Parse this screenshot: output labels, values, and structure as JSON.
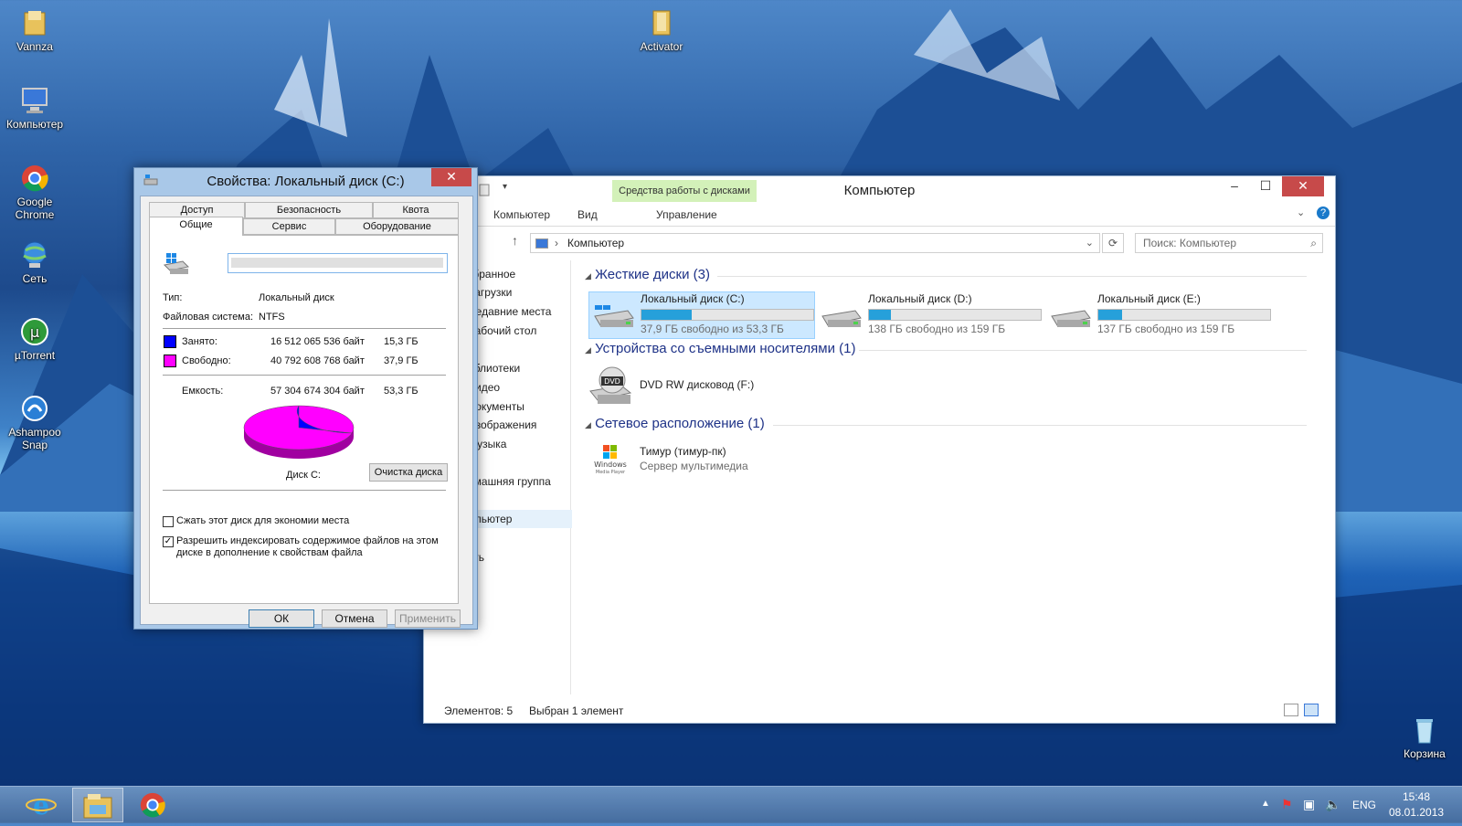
{
  "desktop": {
    "icons": [
      {
        "label": "Vannza",
        "icon": "folder-icon"
      },
      {
        "label": "Компьютер",
        "icon": "computer-icon"
      },
      {
        "label": "Google Chrome",
        "icon": "chrome-icon"
      },
      {
        "label": "Сеть",
        "icon": "network-icon"
      },
      {
        "label": "µTorrent",
        "icon": "utorrent-icon"
      },
      {
        "label": "Ashampoo Snap",
        "icon": "ashampoo-icon"
      },
      {
        "label": "Activator",
        "icon": "folder-icon"
      },
      {
        "label": "Корзина",
        "icon": "recycle-bin-icon"
      }
    ]
  },
  "explorer": {
    "title": "Компьютер",
    "context_tab": "Средства работы с дисками",
    "ribbon": {
      "tab_computer": "Компьютер",
      "tab_view": "Вид",
      "tab_manage": "Управление"
    },
    "address": "Компьютер",
    "search_placeholder": "Поиск: Компьютер",
    "nav": [
      "збранное",
      "Загрузки",
      "Недавние места",
      "Рабочий стол",
      "иблиотеки",
      "Видео",
      "Документы",
      "Изображения",
      "Музыка",
      "омашняя группа",
      "мпьютер",
      "еть"
    ],
    "groups": {
      "hard_disks": "Жесткие диски (3)",
      "removable": "Устройства со съемными носителями (1)",
      "network": "Сетевое расположение (1)"
    },
    "drives": [
      {
        "name": "Локальный диск (C:)",
        "free": "37,9 ГБ свободно из 53,3 ГБ",
        "used_fraction": 0.29
      },
      {
        "name": "Локальный диск (D:)",
        "free": "138 ГБ свободно из 159 ГБ",
        "used_fraction": 0.13
      },
      {
        "name": "Локальный диск (E:)",
        "free": "137 ГБ свободно из 159 ГБ",
        "used_fraction": 0.14
      }
    ],
    "dvd": {
      "name": "DVD RW дисковод (F:)",
      "badge": "DVD"
    },
    "media": {
      "name": "Тимур (тимур-пк)",
      "sub": "Сервер мультимедиа",
      "logo1": "Windows",
      "logo2": "Media Player"
    },
    "status": {
      "count": "Элементов: 5",
      "selected": "Выбран 1 элемент"
    }
  },
  "props": {
    "title": "Свойства: Локальный диск (C:)",
    "tabs_row1": [
      "Доступ",
      "Безопасность",
      "Квота"
    ],
    "tabs_row2": [
      "Общие",
      "Сервис",
      "Оборудование"
    ],
    "name_value": "",
    "type_label": "Тип:",
    "type_value": "Локальный диск",
    "fs_label": "Файловая система:",
    "fs_value": "NTFS",
    "used": {
      "label": "Занято:",
      "bytes": "16 512 065 536 байт",
      "size": "15,3 ГБ",
      "color": "#0000ff",
      "fraction": 0.29
    },
    "free": {
      "label": "Свободно:",
      "bytes": "40 792 608 768 байт",
      "size": "37,9 ГБ",
      "color": "#ff00ff",
      "fraction": 0.71
    },
    "capacity": {
      "label": "Емкость:",
      "bytes": "57 304 674 304 байт",
      "size": "53,3 ГБ"
    },
    "disk_label": "Диск C:",
    "cleanup": "Очистка диска",
    "compress": {
      "label": "Сжать этот диск для экономии места",
      "checked": false
    },
    "index": {
      "label1": "Разрешить индексировать содержимое файлов на этом",
      "label2": "диске в дополнение к свойствам файла",
      "checked": true,
      "mark": "✓"
    },
    "ok": "ОК",
    "cancel": "Отмена",
    "apply": "Применить"
  },
  "taskbar": {
    "lang": "ENG",
    "time": "15:48",
    "date": "08.01.2013"
  }
}
